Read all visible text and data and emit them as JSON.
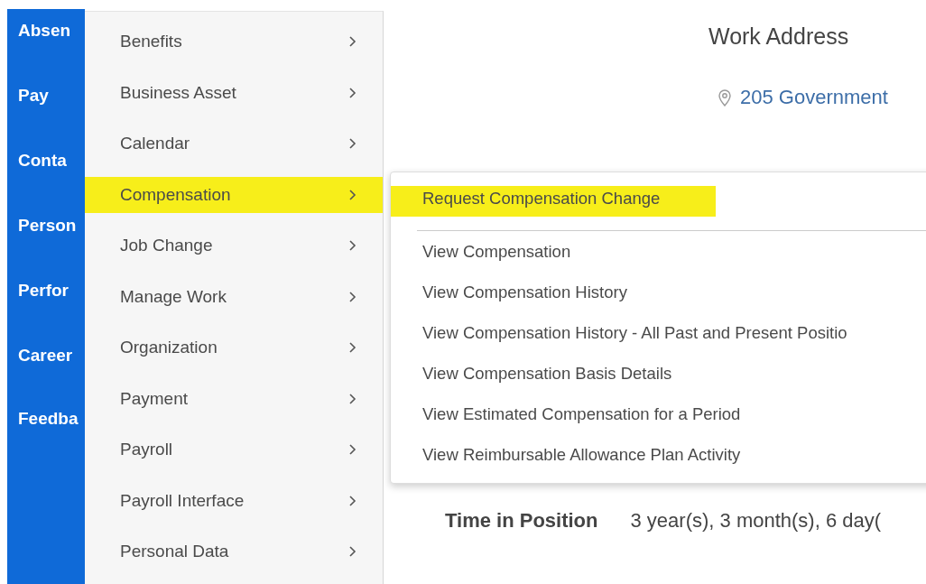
{
  "sidebar": {
    "items": [
      {
        "label": "Absen"
      },
      {
        "label": "Pay"
      },
      {
        "label": "Conta"
      },
      {
        "label": "Person"
      },
      {
        "label": "Perfor"
      },
      {
        "label": "Career"
      },
      {
        "label": "Feedba"
      }
    ]
  },
  "menu": {
    "items": [
      {
        "label": "Benefits",
        "highlighted": false
      },
      {
        "label": "Business Asset",
        "highlighted": false
      },
      {
        "label": "Calendar",
        "highlighted": false
      },
      {
        "label": "Compensation",
        "highlighted": true
      },
      {
        "label": "Job Change",
        "highlighted": false
      },
      {
        "label": "Manage Work",
        "highlighted": false
      },
      {
        "label": "Organization",
        "highlighted": false
      },
      {
        "label": "Payment",
        "highlighted": false
      },
      {
        "label": "Payroll",
        "highlighted": false
      },
      {
        "label": "Payroll Interface",
        "highlighted": false
      },
      {
        "label": "Personal Data",
        "highlighted": false
      }
    ]
  },
  "submenu": {
    "items": [
      {
        "kind": "primary",
        "label": "Request Compensation Change",
        "highlighted": true
      },
      {
        "kind": "item",
        "label": "View Compensation",
        "highlighted": false
      },
      {
        "kind": "item",
        "label": "View Compensation History",
        "highlighted": false
      },
      {
        "kind": "item",
        "label": "View Compensation History - All Past and Present Positio",
        "highlighted": false
      },
      {
        "kind": "item",
        "label": "View Compensation Basis Details",
        "highlighted": false
      },
      {
        "kind": "item",
        "label": "View Estimated Compensation for a Period",
        "highlighted": false
      },
      {
        "kind": "item",
        "label": "View Reimbursable Allowance Plan Activity",
        "highlighted": false
      }
    ]
  },
  "details": {
    "work_address": {
      "heading": "Work Address",
      "address": "205 Government"
    },
    "fields": [
      {
        "label": "Time in Position",
        "value": "3 year(s), 3 month(s), 6 day("
      }
    ]
  }
}
